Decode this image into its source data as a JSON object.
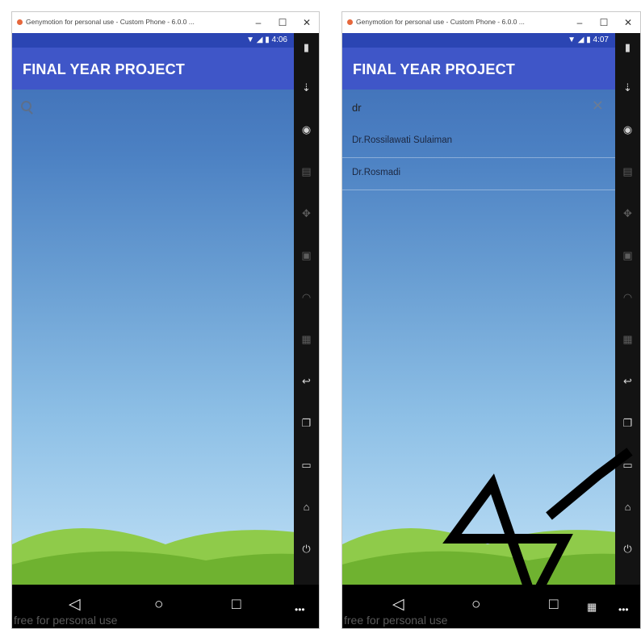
{
  "windows": [
    {
      "title": "Genymotion for personal use - Custom Phone - 6.0.0 ...",
      "controls": {
        "minimize": "–",
        "maximize": "☐",
        "close": "✕"
      },
      "status_time": "4:06",
      "app_title": "FINAL YEAR PROJECT",
      "search": {
        "value": "",
        "icon": "search-icon"
      },
      "results": [],
      "watermark": "free for personal use"
    },
    {
      "title": "Genymotion for personal use - Custom Phone - 6.0.0 ...",
      "controls": {
        "minimize": "–",
        "maximize": "☐",
        "close": "✕"
      },
      "status_time": "4:07",
      "app_title": "FINAL YEAR PROJECT",
      "search": {
        "value": "dr",
        "icon": "close-icon"
      },
      "results": [
        "Dr.Rossilawati Sulaiman",
        "Dr.Rosmadi"
      ],
      "watermark": "free for personal use"
    }
  ],
  "sidebar_icons": [
    "battery-icon",
    "gps-icon",
    "webcam-icon",
    "remote-control-icon",
    "dpad-icon",
    "id-icon",
    "cast-icon",
    "keyboard-icon",
    "back-icon",
    "recent-apps-icon",
    "menu-icon",
    "home-icon",
    "power-icon"
  ],
  "nav": {
    "back": "◁",
    "home": "○",
    "recent": "□",
    "more": "•••"
  },
  "colors": {
    "statusbar": "#2b45b3",
    "appbar": "#3f56c8",
    "sidebar": "#131313",
    "sky_top": "#3c6ab4",
    "sky_bottom": "#bfe0f6",
    "hills": "#7fbe3a"
  }
}
